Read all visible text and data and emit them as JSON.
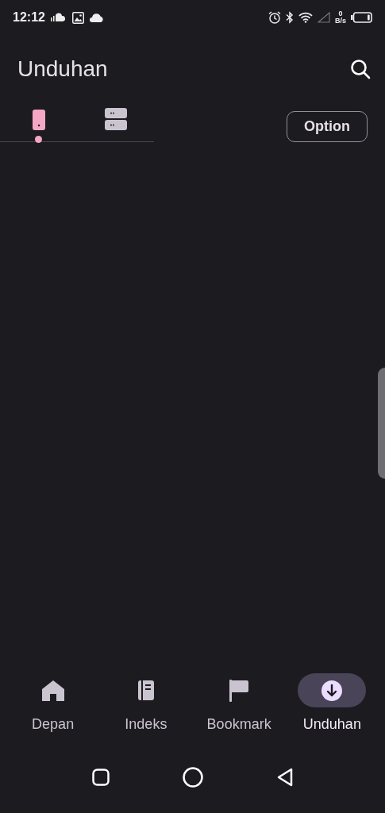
{
  "status_bar": {
    "time": "12:12",
    "net_speed_value": "0",
    "net_speed_unit": "B/s"
  },
  "header": {
    "title": "Unduhan"
  },
  "tabs": [
    {
      "kind": "phone",
      "selected": true
    },
    {
      "kind": "storage",
      "selected": false
    }
  ],
  "option_button": {
    "label": "Option"
  },
  "bottom_nav": [
    {
      "kind": "home",
      "label": "Depan",
      "selected": false
    },
    {
      "kind": "index",
      "label": "Indeks",
      "selected": false
    },
    {
      "kind": "bookmark",
      "label": "Bookmark",
      "selected": false
    },
    {
      "kind": "download",
      "label": "Unduhan",
      "selected": true
    }
  ]
}
